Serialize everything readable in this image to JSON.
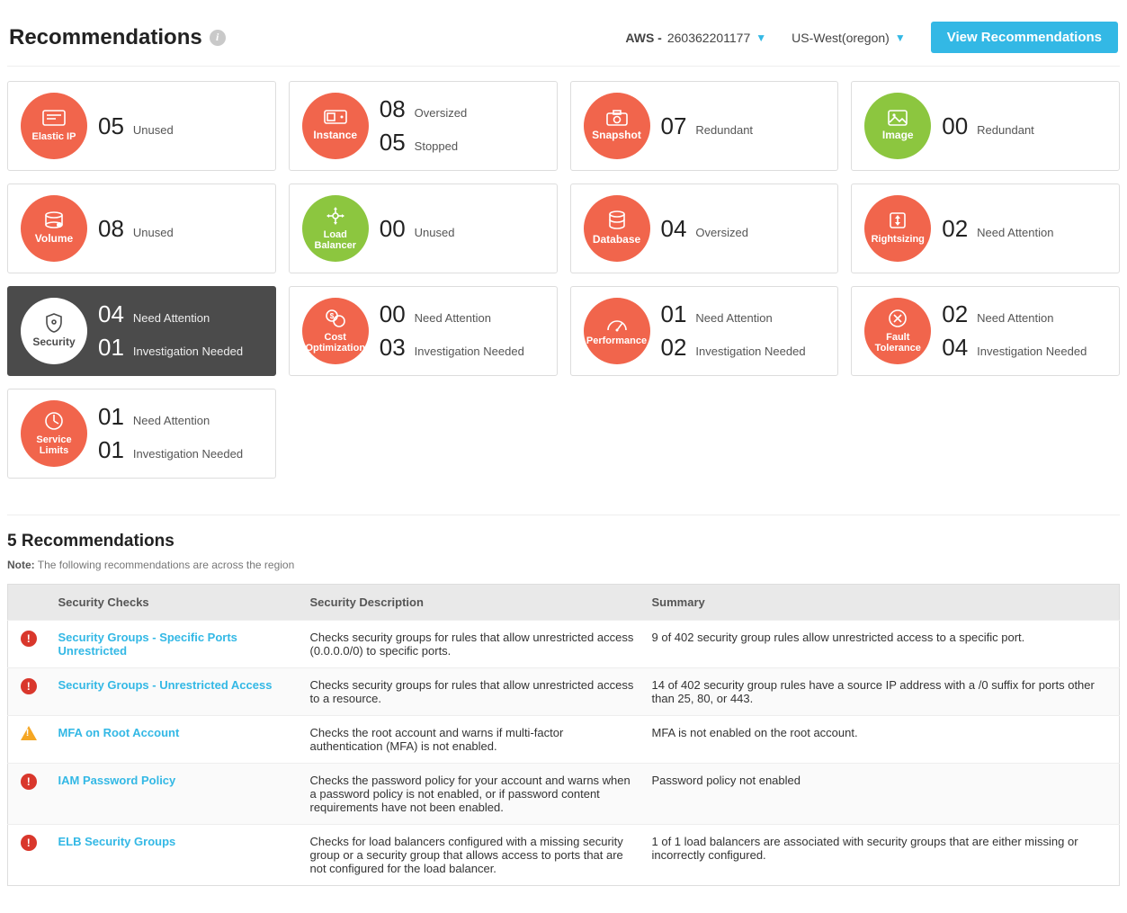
{
  "header": {
    "title": "Recommendations",
    "provider_label": "AWS - ",
    "provider_value": "260362201177",
    "region": "US-West(oregon)",
    "view_btn": "View Recommendations"
  },
  "cards": [
    {
      "id": "elastic-ip",
      "name": "Elastic IP",
      "color": "red",
      "metrics": [
        {
          "num": "05",
          "label": "Unused"
        }
      ]
    },
    {
      "id": "instance",
      "name": "Instance",
      "color": "red",
      "metrics": [
        {
          "num": "08",
          "label": "Oversized"
        },
        {
          "num": "05",
          "label": "Stopped"
        }
      ]
    },
    {
      "id": "snapshot",
      "name": "Snapshot",
      "color": "red",
      "metrics": [
        {
          "num": "07",
          "label": "Redundant"
        }
      ]
    },
    {
      "id": "image",
      "name": "Image",
      "color": "green",
      "metrics": [
        {
          "num": "00",
          "label": "Redundant"
        }
      ]
    },
    {
      "id": "volume",
      "name": "Volume",
      "color": "red",
      "metrics": [
        {
          "num": "08",
          "label": "Unused"
        }
      ]
    },
    {
      "id": "load-balancer",
      "name": "Load\nBalancer",
      "color": "green",
      "metrics": [
        {
          "num": "00",
          "label": "Unused"
        }
      ]
    },
    {
      "id": "database",
      "name": "Database",
      "color": "red",
      "metrics": [
        {
          "num": "04",
          "label": "Oversized"
        }
      ]
    },
    {
      "id": "rightsizing",
      "name": "Rightsizing",
      "color": "red",
      "metrics": [
        {
          "num": "02",
          "label": "Need Attention"
        }
      ]
    },
    {
      "id": "security",
      "name": "Security",
      "color": "dark",
      "metrics": [
        {
          "num": "04",
          "label": "Need Attention"
        },
        {
          "num": "01",
          "label": "Investigation Needed"
        }
      ]
    },
    {
      "id": "cost-optimization",
      "name": "Cost\nOptimization",
      "color": "red",
      "metrics": [
        {
          "num": "00",
          "label": "Need Attention"
        },
        {
          "num": "03",
          "label": "Investigation Needed"
        }
      ]
    },
    {
      "id": "performance",
      "name": "Performance",
      "color": "red",
      "metrics": [
        {
          "num": "01",
          "label": "Need Attention"
        },
        {
          "num": "02",
          "label": "Investigation Needed"
        }
      ]
    },
    {
      "id": "fault-tolerance",
      "name": "Fault\nTolerance",
      "color": "red",
      "metrics": [
        {
          "num": "02",
          "label": "Need Attention"
        },
        {
          "num": "04",
          "label": "Investigation Needed"
        }
      ]
    },
    {
      "id": "service-limits",
      "name": "Service\nLimits",
      "color": "red",
      "metrics": [
        {
          "num": "01",
          "label": "Need Attention"
        },
        {
          "num": "01",
          "label": "Investigation Needed"
        }
      ]
    }
  ],
  "section": {
    "title": "5 Recommendations",
    "note_label": "Note:",
    "note_text": " The following recommendations are across the region"
  },
  "table": {
    "headers": {
      "checks": "Security Checks",
      "desc": "Security Description",
      "summary": "Summary"
    },
    "rows": [
      {
        "severity": "crit",
        "check": "Security Groups - Specific Ports Unrestricted",
        "desc": "Checks security groups for rules that allow unrestricted access (0.0.0.0/0) to specific ports.",
        "summary": "9 of 402 security group rules allow unrestricted access to a specific port."
      },
      {
        "severity": "crit",
        "check": "Security Groups - Unrestricted Access",
        "desc": "Checks security groups for rules that allow unrestricted access to a resource.",
        "summary": "14 of 402 security group rules have a source IP address with a /0 suffix for ports other than 25, 80, or 443."
      },
      {
        "severity": "warn",
        "check": "MFA on Root Account",
        "desc": "Checks the root account and warns if multi-factor authentication (MFA) is not enabled.",
        "summary": "MFA is not enabled on the root account."
      },
      {
        "severity": "crit",
        "check": "IAM Password Policy",
        "desc": "Checks the password policy for your account and warns when a password policy is not enabled, or if password content requirements have not been enabled.",
        "summary": "Password policy not enabled"
      },
      {
        "severity": "crit",
        "check": "ELB Security Groups",
        "desc": "Checks for load balancers configured with a missing security group or a security group that allows access to ports that are not configured for the load balancer.",
        "summary": "1 of 1 load balancers are associated with security groups that are either missing or incorrectly configured."
      }
    ]
  }
}
